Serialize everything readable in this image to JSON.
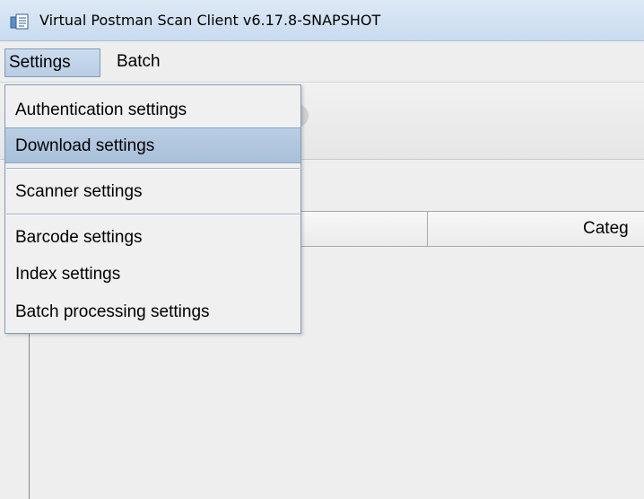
{
  "window": {
    "title": "Virtual Postman Scan Client v6.17.8-SNAPSHOT",
    "icon": "app-document-icon"
  },
  "menubar": {
    "items": [
      {
        "label": "Settings",
        "open": true
      },
      {
        "label": "Batch",
        "open": false
      }
    ]
  },
  "settings_menu": {
    "groups": [
      [
        {
          "label": "Authentication settings"
        },
        {
          "label": "Download settings",
          "highlighted": true
        }
      ],
      [
        {
          "label": "Scanner settings"
        }
      ],
      [
        {
          "label": "Barcode settings"
        },
        {
          "label": "Index settings"
        },
        {
          "label": "Batch processing settings"
        }
      ]
    ]
  },
  "table": {
    "columns": [
      "",
      "Categ"
    ]
  },
  "colors": {
    "titlebar": "#c9dbef",
    "menu_highlight": "#b9cde3",
    "menu_border": "#7f9db9",
    "background": "#eeeeee"
  }
}
